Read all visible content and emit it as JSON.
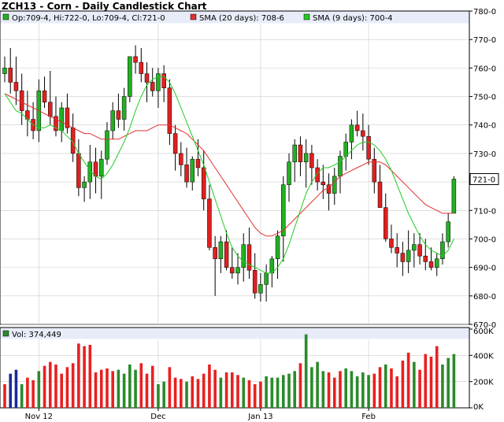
{
  "chart_data": {
    "type": "candlestick",
    "title": "ZCH13 - Corn - Daily Candlestick Chart",
    "legend": {
      "ohlc": "Op:709-4, Hi:722-0, Lo:709-4, Cl:721-0",
      "sma20": "SMA (20 days): 708-6",
      "sma9": "SMA (9 days): 700-4"
    },
    "last_price_label": "721-0",
    "price_ylim": [
      670,
      780
    ],
    "price_ticks": [
      {
        "value": 780,
        "label": "780-0"
      },
      {
        "value": 770,
        "label": "770-0"
      },
      {
        "value": 760,
        "label": "760-0"
      },
      {
        "value": 750,
        "label": "750-0"
      },
      {
        "value": 740,
        "label": "740-0"
      },
      {
        "value": 730,
        "label": "730-0"
      },
      {
        "value": 720,
        "label": "720-0"
      },
      {
        "value": 710,
        "label": "710-0"
      },
      {
        "value": 700,
        "label": "700-0"
      },
      {
        "value": 690,
        "label": "690-0"
      },
      {
        "value": 680,
        "label": "680-0"
      },
      {
        "value": 670,
        "label": "670-0"
      }
    ],
    "x_labels": [
      {
        "index": 6,
        "label": "Nov 12"
      },
      {
        "index": 27,
        "label": "Dec"
      },
      {
        "index": 45,
        "label": "Jan 13"
      },
      {
        "index": 64,
        "label": "Feb"
      }
    ],
    "candles": [
      [
        758,
        764,
        755,
        760
      ],
      [
        760,
        767,
        751,
        755
      ],
      [
        755,
        764,
        747,
        752
      ],
      [
        752,
        758,
        740,
        745
      ],
      [
        745,
        752,
        736,
        742
      ],
      [
        742,
        748,
        735,
        738
      ],
      [
        738,
        756,
        734,
        752
      ],
      [
        752,
        757,
        746,
        748
      ],
      [
        748,
        759,
        740,
        743
      ],
      [
        743,
        750,
        736,
        738
      ],
      [
        738,
        748,
        734,
        746
      ],
      [
        746,
        751,
        737,
        739
      ],
      [
        739,
        744,
        727,
        730
      ],
      [
        730,
        735,
        715,
        718
      ],
      [
        718,
        722,
        713,
        720
      ],
      [
        720,
        733,
        714,
        727
      ],
      [
        727,
        732,
        716,
        722
      ],
      [
        722,
        731,
        714,
        728
      ],
      [
        728,
        741,
        726,
        738
      ],
      [
        738,
        748,
        735,
        745
      ],
      [
        745,
        751,
        739,
        742
      ],
      [
        742,
        753,
        738,
        750
      ],
      [
        750,
        762,
        748,
        764
      ],
      [
        764,
        768,
        758,
        762
      ],
      [
        762,
        767,
        755,
        758
      ],
      [
        758,
        762,
        748,
        755
      ],
      [
        755,
        760,
        750,
        752
      ],
      [
        752,
        760,
        746,
        758
      ],
      [
        758,
        761,
        748,
        753
      ],
      [
        753,
        756,
        733,
        737
      ],
      [
        737,
        740,
        724,
        730
      ],
      [
        730,
        734,
        722,
        726
      ],
      [
        726,
        732,
        718,
        720
      ],
      [
        720,
        729,
        717,
        728
      ],
      [
        728,
        735,
        722,
        725
      ],
      [
        725,
        731,
        710,
        714
      ],
      [
        714,
        719,
        696,
        697
      ],
      [
        697,
        701,
        680,
        693
      ],
      [
        693,
        701,
        688,
        699
      ],
      [
        699,
        703,
        689,
        690
      ],
      [
        690,
        697,
        686,
        688
      ],
      [
        688,
        695,
        684,
        690
      ],
      [
        690,
        702,
        685,
        698
      ],
      [
        698,
        704,
        686,
        689
      ],
      [
        689,
        695,
        679,
        681
      ],
      [
        681,
        688,
        678,
        684
      ],
      [
        684,
        691,
        678,
        688
      ],
      [
        688,
        694,
        683,
        693
      ],
      [
        693,
        703,
        686,
        701
      ],
      [
        701,
        722,
        692,
        719
      ],
      [
        719,
        730,
        713,
        727
      ],
      [
        727,
        735,
        720,
        733
      ],
      [
        733,
        736,
        722,
        727
      ],
      [
        727,
        735,
        718,
        730
      ],
      [
        730,
        733,
        719,
        725
      ],
      [
        725,
        728,
        717,
        720
      ],
      [
        720,
        726,
        714,
        719
      ],
      [
        719,
        723,
        710,
        716
      ],
      [
        716,
        725,
        712,
        722
      ],
      [
        722,
        731,
        716,
        729
      ],
      [
        729,
        737,
        724,
        734
      ],
      [
        734,
        742,
        728,
        740
      ],
      [
        740,
        745,
        736,
        738
      ],
      [
        738,
        744,
        731,
        736
      ],
      [
        736,
        740,
        726,
        728
      ],
      [
        728,
        732,
        716,
        720
      ],
      [
        720,
        726,
        712,
        711
      ],
      [
        711,
        716,
        699,
        700
      ],
      [
        700,
        705,
        695,
        697
      ],
      [
        697,
        702,
        690,
        695
      ],
      [
        695,
        699,
        687,
        692
      ],
      [
        692,
        703,
        688,
        696
      ],
      [
        696,
        702,
        690,
        698
      ],
      [
        698,
        702,
        691,
        694
      ],
      [
        694,
        700,
        689,
        692
      ],
      [
        692,
        697,
        689,
        690
      ],
      [
        690,
        695,
        687,
        693
      ],
      [
        693,
        702,
        691,
        699
      ],
      [
        699,
        709,
        697,
        706
      ],
      [
        709,
        722,
        709,
        721
      ]
    ],
    "sma20": [
      751,
      750,
      749,
      748,
      747,
      746,
      745,
      744,
      743,
      742,
      741,
      740,
      739,
      738,
      737,
      737,
      736,
      735,
      735,
      735,
      735,
      736,
      737,
      738,
      738,
      738,
      739,
      740,
      740,
      740,
      739,
      738,
      737,
      735,
      733,
      731,
      728,
      725,
      722,
      719,
      716,
      713,
      710,
      707,
      704,
      702,
      701,
      701,
      702,
      703,
      705,
      707,
      709,
      711,
      713,
      715,
      717,
      718,
      720,
      722,
      723,
      724,
      725,
      726,
      727,
      727,
      727,
      726,
      724,
      722,
      720,
      718,
      716,
      714,
      712,
      711,
      710,
      709,
      709,
      709
    ],
    "sma9": [
      751,
      748,
      745,
      744,
      742,
      740,
      739,
      739,
      740,
      739,
      738,
      736,
      734,
      730,
      727,
      724,
      722,
      721,
      723,
      726,
      730,
      734,
      739,
      745,
      750,
      754,
      756,
      757,
      757,
      755,
      751,
      746,
      741,
      736,
      731,
      726,
      720,
      714,
      708,
      702,
      697,
      694,
      692,
      691,
      690,
      689,
      688,
      688,
      690,
      693,
      698,
      704,
      710,
      716,
      720,
      723,
      725,
      725,
      726,
      727,
      729,
      731,
      733,
      734,
      734,
      733,
      731,
      728,
      724,
      719,
      714,
      709,
      705,
      701,
      698,
      696,
      695,
      694,
      696,
      700
    ],
    "volume_ylim": [
      0,
      600000
    ],
    "volume_ticks": [
      {
        "value": 0,
        "label": "0K"
      },
      {
        "value": 200000,
        "label": "200K"
      },
      {
        "value": 400000,
        "label": "400K"
      },
      {
        "value": 600000,
        "label": "600K"
      }
    ],
    "volume_label": "Vol: 374,449",
    "volume": [
      [
        180000,
        "red"
      ],
      [
        260000,
        "blue"
      ],
      [
        290000,
        "blue"
      ],
      [
        180000,
        "green"
      ],
      [
        230000,
        "red"
      ],
      [
        210000,
        "red"
      ],
      [
        280000,
        "green"
      ],
      [
        320000,
        "red"
      ],
      [
        350000,
        "red"
      ],
      [
        330000,
        "red"
      ],
      [
        260000,
        "red"
      ],
      [
        310000,
        "red"
      ],
      [
        340000,
        "red"
      ],
      [
        490000,
        "red"
      ],
      [
        470000,
        "red"
      ],
      [
        480000,
        "red"
      ],
      [
        270000,
        "red"
      ],
      [
        290000,
        "red"
      ],
      [
        300000,
        "red"
      ],
      [
        280000,
        "red"
      ],
      [
        290000,
        "green"
      ],
      [
        260000,
        "green"
      ],
      [
        330000,
        "green"
      ],
      [
        290000,
        "green"
      ],
      [
        340000,
        "red"
      ],
      [
        260000,
        "red"
      ],
      [
        320000,
        "red"
      ],
      [
        180000,
        "green"
      ],
      [
        200000,
        "green"
      ],
      [
        310000,
        "red"
      ],
      [
        230000,
        "red"
      ],
      [
        220000,
        "red"
      ],
      [
        200000,
        "green"
      ],
      [
        240000,
        "red"
      ],
      [
        220000,
        "red"
      ],
      [
        260000,
        "red"
      ],
      [
        330000,
        "red"
      ],
      [
        290000,
        "red"
      ],
      [
        230000,
        "green"
      ],
      [
        270000,
        "red"
      ],
      [
        270000,
        "red"
      ],
      [
        250000,
        "red"
      ],
      [
        230000,
        "green"
      ],
      [
        210000,
        "red"
      ],
      [
        180000,
        "red"
      ],
      [
        200000,
        "red"
      ],
      [
        240000,
        "green"
      ],
      [
        230000,
        "green"
      ],
      [
        230000,
        "green"
      ],
      [
        250000,
        "green"
      ],
      [
        260000,
        "green"
      ],
      [
        280000,
        "green"
      ],
      [
        340000,
        "red"
      ],
      [
        560000,
        "green"
      ],
      [
        310000,
        "green"
      ],
      [
        350000,
        "green"
      ],
      [
        280000,
        "green"
      ],
      [
        270000,
        "red"
      ],
      [
        230000,
        "red"
      ],
      [
        280000,
        "red"
      ],
      [
        300000,
        "green"
      ],
      [
        280000,
        "green"
      ],
      [
        240000,
        "green"
      ],
      [
        270000,
        "green"
      ],
      [
        250000,
        "green"
      ],
      [
        260000,
        "red"
      ],
      [
        310000,
        "red"
      ],
      [
        330000,
        "green"
      ],
      [
        300000,
        "red"
      ],
      [
        240000,
        "red"
      ],
      [
        360000,
        "red"
      ],
      [
        420000,
        "red"
      ],
      [
        350000,
        "green"
      ],
      [
        290000,
        "red"
      ],
      [
        410000,
        "red"
      ],
      [
        390000,
        "red"
      ],
      [
        470000,
        "red"
      ],
      [
        330000,
        "green"
      ],
      [
        380000,
        "green"
      ],
      [
        410000,
        "green"
      ]
    ],
    "colors": {
      "up": "#22b022",
      "down": "#e02020",
      "vol_green": "#2a8a2a",
      "vol_red": "#e82020",
      "vol_blue": "#1a2a9a",
      "sma20": "#e03030",
      "sma9": "#22cc22",
      "grid": "#cccccc",
      "header": "#e8ecf8"
    }
  }
}
